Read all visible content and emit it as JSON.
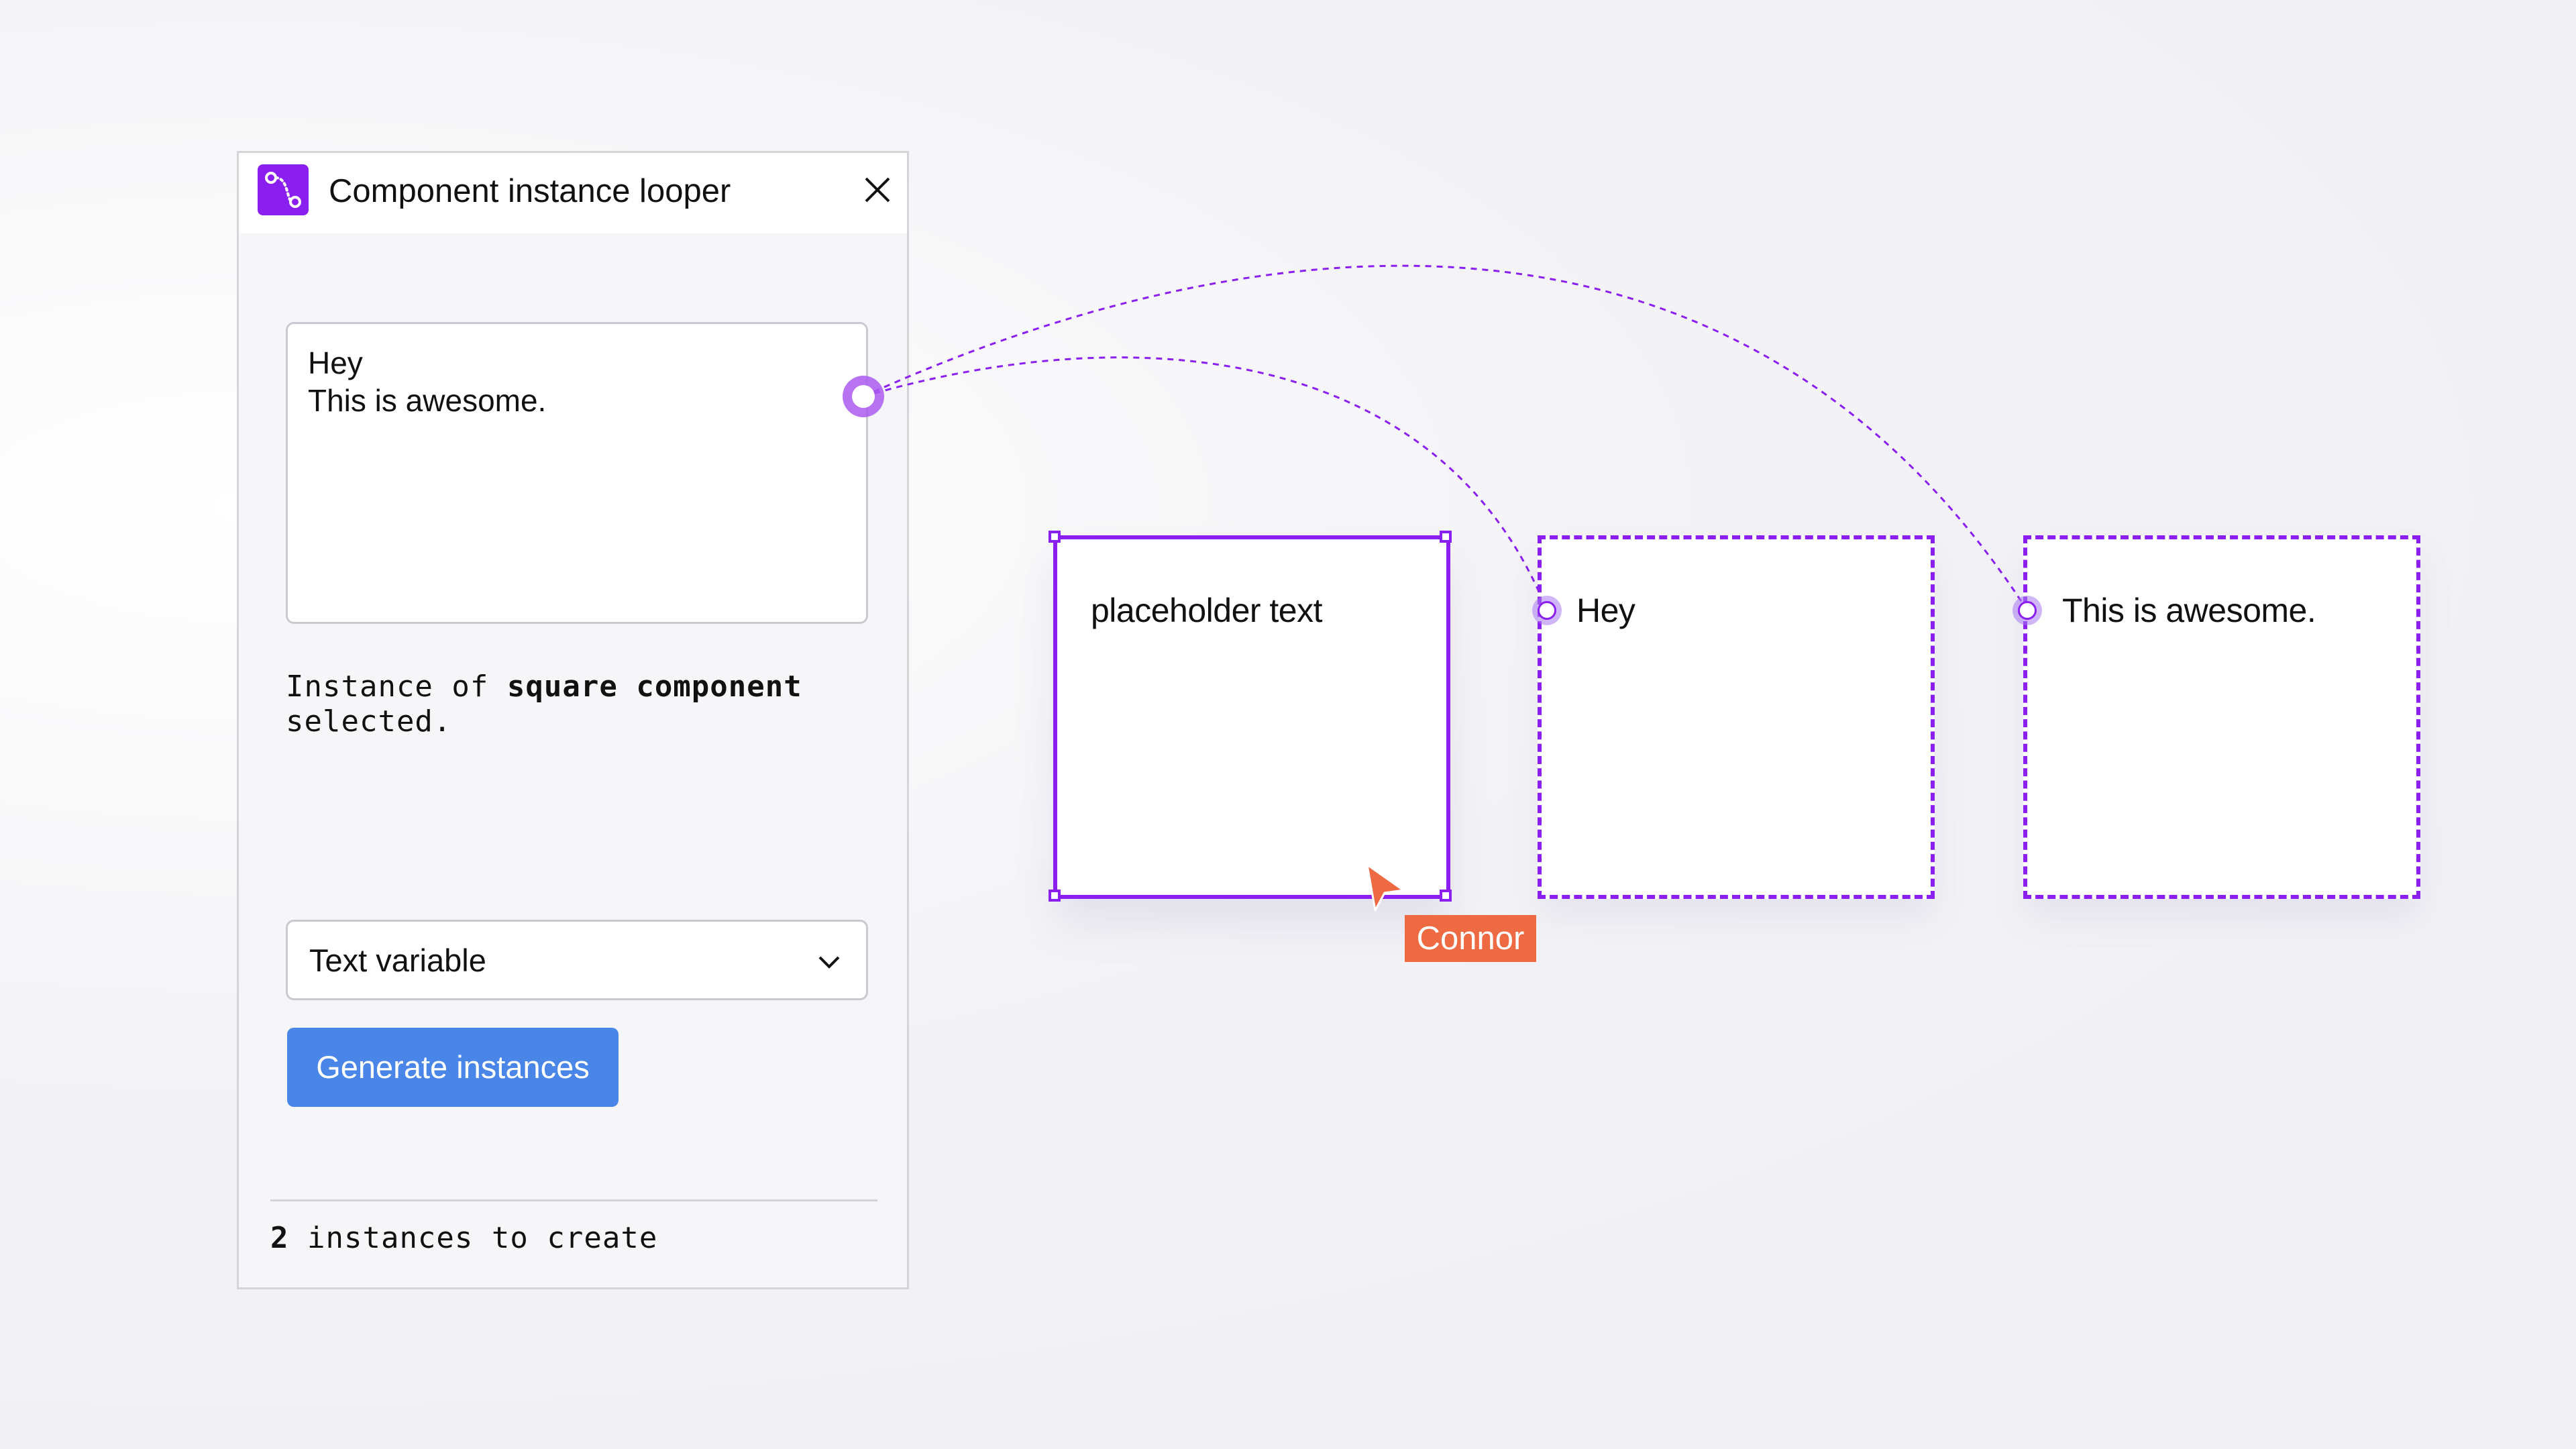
{
  "plugin": {
    "title": "Component instance looper",
    "icon": "looper-plugin-icon",
    "close_icon": "close-icon",
    "textarea_lines": [
      "Hey",
      "This is awesome."
    ],
    "instance_info": {
      "prefix": "Instance of ",
      "component": "square component",
      "suffix": "selected."
    },
    "select": {
      "value": "Text variable",
      "icon": "chevron-down-icon"
    },
    "generate_button": "Generate instances",
    "footer": {
      "count": "2",
      "text": " instances to create"
    }
  },
  "canvas": {
    "source_box": {
      "text": "placeholder text"
    },
    "instances": [
      {
        "text": "Hey"
      },
      {
        "text": "This is awesome."
      }
    ],
    "cursor": {
      "user": "Connor",
      "color": "#ee6a43"
    }
  },
  "colors": {
    "accent": "#8a1ff0",
    "button": "#4a86e8",
    "cursor": "#ee6a43"
  }
}
